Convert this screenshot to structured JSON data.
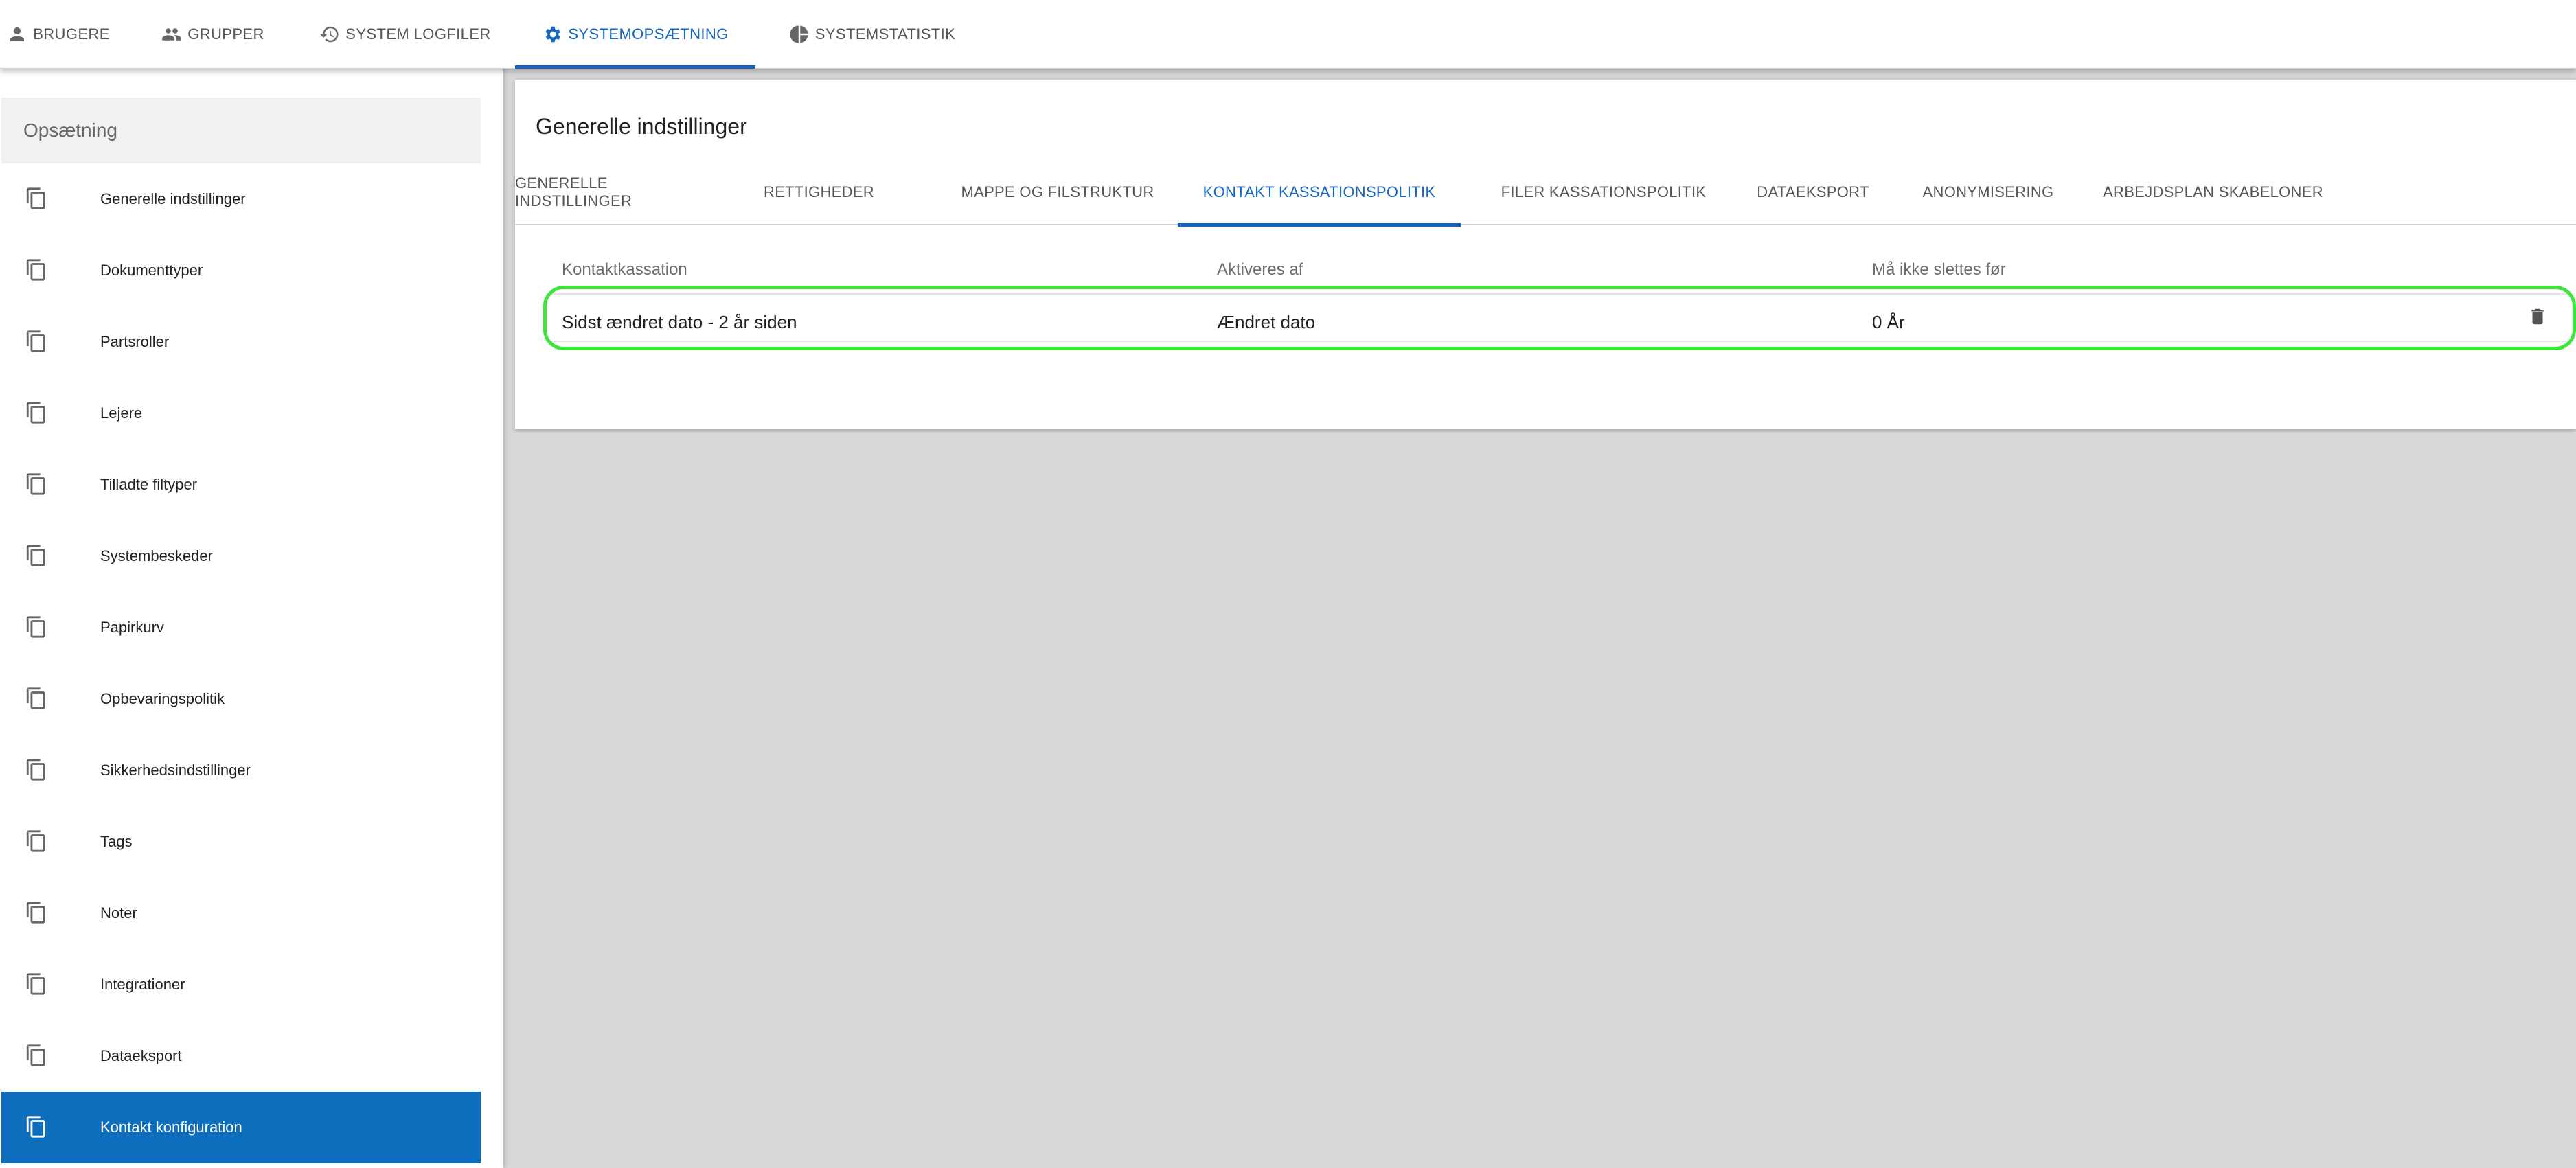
{
  "topnav": {
    "tabs": [
      {
        "label": "BRUGERE",
        "icon": "person-icon"
      },
      {
        "label": "GRUPPER",
        "icon": "group-icon"
      },
      {
        "label": "SYSTEM LOGFILER",
        "icon": "history-icon"
      },
      {
        "label": "SYSTEMOPSÆTNING",
        "icon": "gear-icon",
        "active": true
      },
      {
        "label": "SYSTEMSTATISTIK",
        "icon": "pie-chart-icon"
      }
    ]
  },
  "sidebar": {
    "header": "Opsætning",
    "items": [
      {
        "label": "Generelle indstillinger"
      },
      {
        "label": "Dokumenttyper"
      },
      {
        "label": "Partsroller"
      },
      {
        "label": "Lejere"
      },
      {
        "label": "Tilladte filtyper"
      },
      {
        "label": "Systembeskeder"
      },
      {
        "label": "Papirkurv"
      },
      {
        "label": "Opbevaringspolitik"
      },
      {
        "label": "Sikkerhedsindstillinger"
      },
      {
        "label": "Tags"
      },
      {
        "label": "Noter"
      },
      {
        "label": "Integrationer"
      },
      {
        "label": "Dataeksport"
      },
      {
        "label": "Kontakt konfiguration",
        "active": true
      }
    ]
  },
  "main": {
    "title": "Generelle indstillinger",
    "tabs": [
      {
        "label": "GENERELLE INDSTILLINGER"
      },
      {
        "label": "RETTIGHEDER"
      },
      {
        "label": "MAPPE OG FILSTRUKTUR"
      },
      {
        "label": "KONTAKT KASSATIONSPOLITIK",
        "active": true
      },
      {
        "label": "FILER KASSATIONSPOLITIK"
      },
      {
        "label": "DATAEKSPORT"
      },
      {
        "label": "ANONYMISERING"
      },
      {
        "label": "ARBEJDSPLAN SKABELONER"
      }
    ],
    "table": {
      "columns": [
        "Kontaktkassation",
        "Aktiveres af",
        "Må ikke slettes før"
      ],
      "rows": [
        {
          "kassation": "Sidst ændret dato - 2 år siden",
          "aktiveres_af": "Ændret dato",
          "frist": "0 År"
        }
      ]
    }
  },
  "colors": {
    "accent": "#1565c0",
    "sidebar_active": "#0d6ebd",
    "highlight": "#3ee63a",
    "background": "#d8d8d8"
  }
}
